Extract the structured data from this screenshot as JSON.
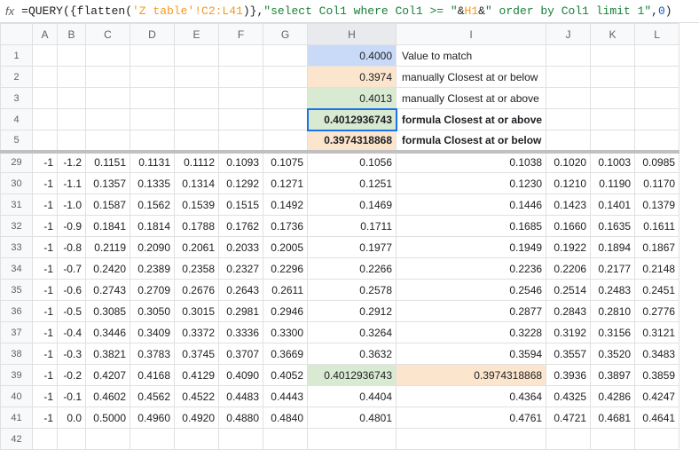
{
  "formula_bar": {
    "fx": "fx",
    "eq": "=",
    "fn_query": "QUERY",
    "fn_flatten": "flatten",
    "range": "'Z table'!C2:L41",
    "str1": "\"select Col1 where Col1 >= \"",
    "amp": "&",
    "ref": "H1",
    "str2": "\" order by Col1 limit 1\"",
    "comma": ",",
    "zero": "0",
    "open_p": "(",
    "close_p": ")",
    "open_b": "{",
    "close_b": "}"
  },
  "columns": [
    "A",
    "B",
    "C",
    "D",
    "E",
    "F",
    "G",
    "H",
    "I",
    "J",
    "K",
    "L"
  ],
  "top_rows": [
    {
      "num": "1",
      "H": "0.4000",
      "Hclass": "fill-blue",
      "I": "Value to match"
    },
    {
      "num": "2",
      "H": "0.3974",
      "Hclass": "fill-orange",
      "I": "manually Closest at or below"
    },
    {
      "num": "3",
      "H": "0.4013",
      "Hclass": "fill-green",
      "I": "manually Closest at or above"
    },
    {
      "num": "4",
      "H": "0.4012936743",
      "Hclass": "fill-green sel-cell bold",
      "I": "formula Closest at or above",
      "Ibold": true
    },
    {
      "num": "5",
      "H": "0.3974318868",
      "Hclass": "fill-orange bold",
      "I": "formula Closest at or below",
      "Ibold": true
    }
  ],
  "data_rows": [
    {
      "num": "29",
      "A": "-1",
      "B": "-1.2",
      "C": "0.1151",
      "D": "0.1131",
      "E": "0.1112",
      "F": "0.1093",
      "G": "0.1075",
      "H": "0.1056",
      "I": "0.1038",
      "J": "0.1020",
      "K": "0.1003",
      "L": "0.0985"
    },
    {
      "num": "30",
      "A": "-1",
      "B": "-1.1",
      "C": "0.1357",
      "D": "0.1335",
      "E": "0.1314",
      "F": "0.1292",
      "G": "0.1271",
      "H": "0.1251",
      "I": "0.1230",
      "J": "0.1210",
      "K": "0.1190",
      "L": "0.1170"
    },
    {
      "num": "31",
      "A": "-1",
      "B": "-1.0",
      "C": "0.1587",
      "D": "0.1562",
      "E": "0.1539",
      "F": "0.1515",
      "G": "0.1492",
      "H": "0.1469",
      "I": "0.1446",
      "J": "0.1423",
      "K": "0.1401",
      "L": "0.1379"
    },
    {
      "num": "32",
      "A": "-1",
      "B": "-0.9",
      "C": "0.1841",
      "D": "0.1814",
      "E": "0.1788",
      "F": "0.1762",
      "G": "0.1736",
      "H": "0.1711",
      "I": "0.1685",
      "J": "0.1660",
      "K": "0.1635",
      "L": "0.1611"
    },
    {
      "num": "33",
      "A": "-1",
      "B": "-0.8",
      "C": "0.2119",
      "D": "0.2090",
      "E": "0.2061",
      "F": "0.2033",
      "G": "0.2005",
      "H": "0.1977",
      "I": "0.1949",
      "J": "0.1922",
      "K": "0.1894",
      "L": "0.1867"
    },
    {
      "num": "34",
      "A": "-1",
      "B": "-0.7",
      "C": "0.2420",
      "D": "0.2389",
      "E": "0.2358",
      "F": "0.2327",
      "G": "0.2296",
      "H": "0.2266",
      "I": "0.2236",
      "J": "0.2206",
      "K": "0.2177",
      "L": "0.2148"
    },
    {
      "num": "35",
      "A": "-1",
      "B": "-0.6",
      "C": "0.2743",
      "D": "0.2709",
      "E": "0.2676",
      "F": "0.2643",
      "G": "0.2611",
      "H": "0.2578",
      "I": "0.2546",
      "J": "0.2514",
      "K": "0.2483",
      "L": "0.2451"
    },
    {
      "num": "36",
      "A": "-1",
      "B": "-0.5",
      "C": "0.3085",
      "D": "0.3050",
      "E": "0.3015",
      "F": "0.2981",
      "G": "0.2946",
      "H": "0.2912",
      "I": "0.2877",
      "J": "0.2843",
      "K": "0.2810",
      "L": "0.2776"
    },
    {
      "num": "37",
      "A": "-1",
      "B": "-0.4",
      "C": "0.3446",
      "D": "0.3409",
      "E": "0.3372",
      "F": "0.3336",
      "G": "0.3300",
      "H": "0.3264",
      "I": "0.3228",
      "J": "0.3192",
      "K": "0.3156",
      "L": "0.3121"
    },
    {
      "num": "38",
      "A": "-1",
      "B": "-0.3",
      "C": "0.3821",
      "D": "0.3783",
      "E": "0.3745",
      "F": "0.3707",
      "G": "0.3669",
      "H": "0.3632",
      "I": "0.3594",
      "J": "0.3557",
      "K": "0.3520",
      "L": "0.3483"
    },
    {
      "num": "39",
      "A": "-1",
      "B": "-0.2",
      "C": "0.4207",
      "D": "0.4168",
      "E": "0.4129",
      "F": "0.4090",
      "G": "0.4052",
      "H": "0.4012936743",
      "Hclass": "fill-green",
      "I": "0.3974318868",
      "Iclass": "fill-orange",
      "J": "0.3936",
      "K": "0.3897",
      "L": "0.3859"
    },
    {
      "num": "40",
      "A": "-1",
      "B": "-0.1",
      "C": "0.4602",
      "D": "0.4562",
      "E": "0.4522",
      "F": "0.4483",
      "G": "0.4443",
      "H": "0.4404",
      "I": "0.4364",
      "J": "0.4325",
      "K": "0.4286",
      "L": "0.4247"
    },
    {
      "num": "41",
      "A": "-1",
      "B": "0.0",
      "C": "0.5000",
      "D": "0.4960",
      "E": "0.4920",
      "F": "0.4880",
      "G": "0.4840",
      "H": "0.4801",
      "I": "0.4761",
      "J": "0.4721",
      "K": "0.4681",
      "L": "0.4641"
    },
    {
      "num": "42",
      "A": "",
      "B": "",
      "C": "",
      "D": "",
      "E": "",
      "F": "",
      "G": "",
      "H": "",
      "I": "",
      "J": "",
      "K": "",
      "L": ""
    }
  ]
}
